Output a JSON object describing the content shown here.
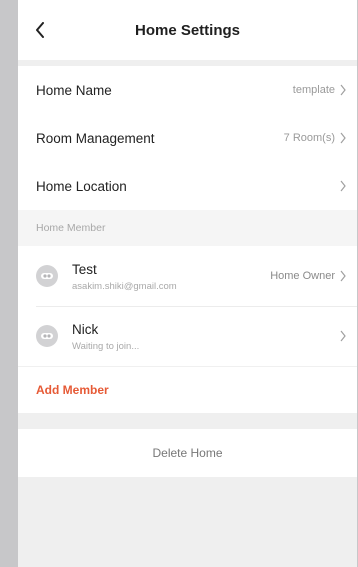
{
  "header": {
    "title": "Home Settings"
  },
  "settings": {
    "items": [
      {
        "label": "Home Name",
        "value": "template"
      },
      {
        "label": "Room Management",
        "value": "7 Room(s)"
      },
      {
        "label": "Home Location",
        "value": ""
      }
    ]
  },
  "members": {
    "section_label": "Home Member",
    "list": [
      {
        "name": "Test",
        "sub": "asakim.shiki@gmail.com",
        "role": "Home Owner"
      },
      {
        "name": "Nick",
        "sub": "Waiting to join...",
        "role": ""
      }
    ],
    "add_label": "Add Member"
  },
  "actions": {
    "delete_label": "Delete Home"
  },
  "colors": {
    "accent": "#e65a36",
    "header_bg": "#ffffff",
    "page_bg": "#efefef"
  },
  "icons": {
    "back": "chevron-left-icon",
    "row_arrow": "chevron-right-icon",
    "avatar": "default-avatar-icon"
  }
}
